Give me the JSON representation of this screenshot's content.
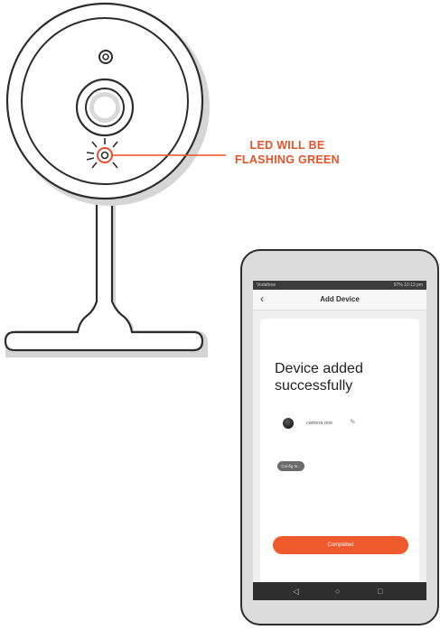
{
  "callout": {
    "line1": "LED WILL BE",
    "line2": "FLASHING GREEN",
    "color": "#E8522A"
  },
  "phone": {
    "status_bar": {
      "carrier": "Vodafone",
      "info": "97% 10:13 pm"
    },
    "app_bar": {
      "back_icon": "chevron-left-icon",
      "title": "Add Device"
    },
    "card": {
      "heading": "Device added successfully",
      "device": {
        "name": "camera one",
        "edit_icon": "pencil-icon"
      },
      "config_pill": "Config N...",
      "completed_button": "Completed"
    },
    "nav": {
      "back": "◁",
      "home": "○",
      "recent": "□"
    }
  },
  "colors": {
    "accent": "#EE5A2B",
    "outline": "#2c2c2c"
  }
}
